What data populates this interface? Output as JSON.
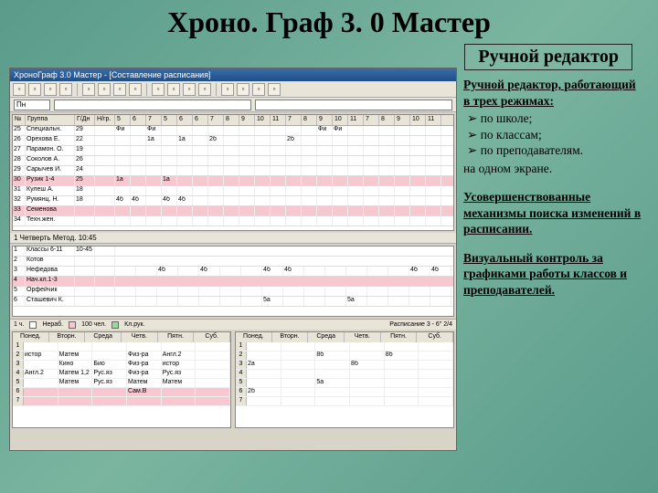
{
  "title": "Хроно. Граф 3. 0 Мастер",
  "subtitle": "Ручной редактор",
  "right": {
    "h1": "Ручной редактор, работающий в трех режимах:",
    "items": [
      "по школе;",
      "по классам;",
      "по преподавателям."
    ],
    "tail": "на одном экране.",
    "p2": "Усовершенствованные механизмы поиска изменений в расписании.",
    "p3": "Визуальный контроль за графиками работы классов и преподавателей."
  },
  "app": {
    "window_title": "ХроноГраф 3.0 Мастер - [Составление расписания]",
    "toolbar_icons": [
      "file",
      "open",
      "save",
      "print",
      "cut",
      "copy",
      "paste",
      "undo",
      "redo",
      "find",
      "grid",
      "cfg",
      "help",
      "A",
      "B",
      "C"
    ],
    "combo_labels": {
      "left": "Пн",
      "mid": "",
      "right": ""
    },
    "top_grid": {
      "cols": [
        "№",
        "Группа",
        "Г/Дн",
        "Н/гр.",
        "5",
        "6",
        "7",
        "5",
        "6",
        "6",
        "7",
        "8",
        "9",
        "10",
        "11",
        "7",
        "8",
        "9",
        "10",
        "11",
        "7",
        "8",
        "9",
        "10",
        "11"
      ],
      "rows": [
        {
          "n": "25",
          "name": "Специальн.",
          "g": "29",
          "h": "",
          "cells": [
            "Фи",
            "",
            "Фи",
            "",
            "",
            "",
            "",
            "",
            "",
            "",
            "",
            "",
            "",
            "Фи",
            "Фи",
            "",
            "",
            "",
            "",
            "",
            ""
          ]
        },
        {
          "n": "26",
          "name": "Орехова Е.",
          "g": "22",
          "h": "",
          "cells": [
            "",
            "",
            "1а",
            "",
            "1а",
            "",
            "2б",
            "",
            "",
            "",
            "",
            "2б",
            "",
            "",
            "",
            "",
            "",
            "",
            "",
            "",
            ""
          ]
        },
        {
          "n": "27",
          "name": "Парамон. О.",
          "g": "19",
          "h": "",
          "cells": [
            "",
            "",
            "",
            "",
            "",
            "",
            "",
            "",
            "",
            "",
            "",
            "",
            "",
            "",
            "",
            "",
            "",
            "",
            "",
            "",
            ""
          ]
        },
        {
          "n": "28",
          "name": "Соколов А.",
          "g": "26",
          "h": "",
          "cells": [
            "",
            "",
            "",
            "",
            "",
            "",
            "",
            "",
            "",
            "",
            "",
            "",
            "",
            "",
            "",
            "",
            "",
            "",
            "",
            "",
            ""
          ]
        },
        {
          "n": "29",
          "name": "Сарычев И.",
          "g": "24",
          "h": "",
          "cells": [
            "",
            "",
            "",
            "",
            "",
            "",
            "",
            "",
            "",
            "",
            "",
            "",
            "",
            "",
            "",
            "",
            "",
            "",
            "",
            "",
            ""
          ]
        },
        {
          "n": "30",
          "name": "Рузик 1-4",
          "g": "25",
          "h": "",
          "cells": [
            "1а",
            "",
            "",
            "1а",
            "",
            "",
            "",
            "",
            "",
            "",
            "",
            "",
            "",
            "",
            "",
            "",
            "",
            "",
            "",
            "",
            ""
          ],
          "pink": true
        },
        {
          "n": "31",
          "name": "Кулеш А.",
          "g": "18",
          "h": "",
          "cells": [
            "",
            "",
            "",
            "",
            "",
            "",
            "",
            "",
            "",
            "",
            "",
            "",
            "",
            "",
            "",
            "",
            "",
            "",
            "",
            "",
            ""
          ]
        },
        {
          "n": "32",
          "name": "Румянц. Н.",
          "g": "18",
          "h": "",
          "cells": [
            "4б",
            "4б",
            "",
            "4б",
            "4б",
            "",
            "",
            "",
            "",
            "",
            "",
            "",
            "",
            "",
            "",
            "",
            "",
            "",
            "",
            "",
            ""
          ]
        },
        {
          "n": "33",
          "name": "Семенова",
          "g": "",
          "h": "",
          "cells": [
            "",
            "",
            "",
            "",
            "",
            "",
            "",
            "",
            "",
            "",
            "",
            "",
            "",
            "",
            "",
            "",
            "",
            "",
            "",
            "",
            ""
          ],
          "pink": true
        },
        {
          "n": "34",
          "name": "Техн.жен.",
          "g": "",
          "h": "",
          "cells": [
            "",
            "",
            "",
            "",
            "",
            "",
            "",
            "",
            "",
            "",
            "",
            "",
            "",
            "",
            "",
            "",
            "",
            "",
            "",
            "",
            ""
          ]
        }
      ]
    },
    "mid_label": "1 Четверть  Метод.  10:45",
    "mid_rows": [
      {
        "n": "1",
        "name": "Классы 6-11",
        "g": "10-45",
        "cells": []
      },
      {
        "n": "2",
        "name": "Котов",
        "g": "",
        "cells": []
      },
      {
        "n": "3",
        "name": "Нефедова",
        "g": "",
        "cells": [
          "",
          "",
          "4б",
          "",
          "4б",
          "",
          "",
          "4б",
          "4б",
          "",
          "",
          "",
          "",
          "",
          "4б",
          "4б"
        ]
      },
      {
        "n": "4",
        "name": "Нач.кл.1-3",
        "g": "",
        "cells": [],
        "pink": true
      },
      {
        "n": "5",
        "name": "Орфейчик",
        "g": "",
        "cells": [
          "",
          "",
          "",
          "",
          "",
          "",
          "",
          "",
          "",
          "",
          "",
          "",
          "",
          "",
          "",
          ""
        ]
      },
      {
        "n": "6",
        "name": "Сташевич К.",
        "g": "",
        "cells": [
          "",
          "",
          "",
          "",
          "",
          "",
          "",
          "5а",
          "",
          "",
          "",
          "5а",
          "",
          "",
          "",
          ""
        ]
      }
    ],
    "footer_legend": [
      "1 ч.",
      "",
      "Нераб.",
      "",
      "100 чел.",
      "",
      "Кл.рук."
    ],
    "days": [
      "Понед.",
      "Вторн.",
      "Среда",
      "Четв.",
      "Пятн.",
      "Суб."
    ],
    "bottom_left": [
      [
        "",
        "",
        "",
        "",
        "",
        ""
      ],
      [
        "истор",
        "Матем",
        "",
        "Физ-ра",
        "Англ.2",
        ""
      ],
      [
        "",
        "Кино",
        "Био",
        "Физ-ра",
        "истор",
        ""
      ],
      [
        "Англ.2",
        "Матем 1,2",
        "Рус.яз",
        "Физ-ра",
        "Рус.яз",
        ""
      ],
      [
        "",
        "Матем",
        "Рус.яз",
        "Матем",
        "Матем",
        ""
      ],
      [
        "",
        "",
        "",
        "Сам.В",
        "",
        ""
      ],
      [
        "",
        "",
        "",
        "",
        "",
        ""
      ]
    ],
    "bottom_left_pink_rows": [
      6,
      7
    ],
    "bottom_right": [
      [
        "",
        "",
        "",
        "",
        "",
        ""
      ],
      [
        "",
        "",
        "8б",
        "",
        "8б",
        ""
      ],
      [
        "2а",
        "",
        "",
        "8б",
        "",
        ""
      ],
      [
        "",
        "",
        "",
        "",
        "",
        ""
      ],
      [
        "",
        "",
        "5а",
        "",
        "",
        ""
      ],
      [
        "2б",
        "",
        "",
        "",
        "",
        ""
      ],
      [
        "",
        "",
        "",
        "",
        "",
        ""
      ]
    ],
    "mid_right_label": "Расписание 3 - 6\" 2/4"
  }
}
